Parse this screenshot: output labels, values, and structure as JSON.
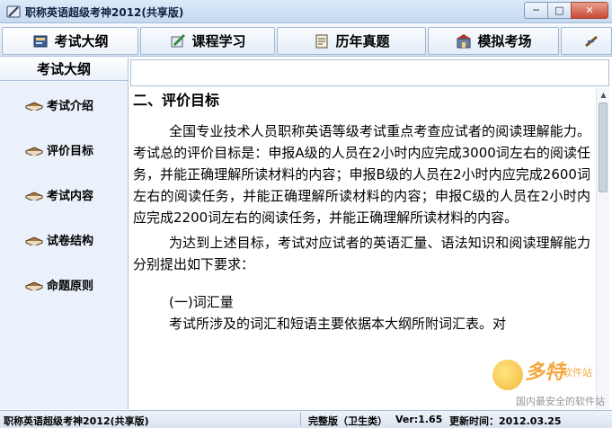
{
  "window": {
    "title": "职称英语超级考神2012(共享版)",
    "minimize_glyph": "─",
    "maximize_glyph": "□",
    "close_glyph": "✕"
  },
  "topnav": {
    "tabs": [
      {
        "label": "考试大纲",
        "icon": "book-icon"
      },
      {
        "label": "课程学习",
        "icon": "pencil-icon"
      },
      {
        "label": "历年真题",
        "icon": "test-paper-icon"
      },
      {
        "label": "模拟考场",
        "icon": "building-icon"
      }
    ]
  },
  "sidebar": {
    "header": "考试大纲",
    "items": [
      {
        "label": "考试介绍"
      },
      {
        "label": "评价目标"
      },
      {
        "label": "考试内容"
      },
      {
        "label": "试卷结构"
      },
      {
        "label": "命题原则"
      }
    ]
  },
  "content": {
    "heading": "二、评价目标",
    "para1": "全国专业技术人员职称英语等级考试重点考查应试者的阅读理解能力。考试总的评价目标是：申报A级的人员在2小时内应完成3000词左右的阅读任务，并能正确理解所读材料的内容；申报B级的人员在2小时内应完成2600词左右的阅读任务，并能正确理解所读材料的内容；申报C级的人员在2小时内应完成2200词左右的阅读任务，并能正确理解所读材料的内容。",
    "para2": "为达到上述目标，考试对应试者的英语汇量、语法知识和阅读理解能力分别提出如下要求：",
    "subheading": "(一)词汇量",
    "para3": "考试所涉及的词汇和短语主要依据本大纲所附词汇表。对"
  },
  "statusbar": {
    "app_name": "职称英语超级考神2012(共享版)",
    "edition": "完整版（卫生类）",
    "version": "Ver:1.65",
    "update_time": "更新时间：2012.03.25"
  },
  "watermark": {
    "brand": "多特",
    "brand_sub": "软件站",
    "slogan": "国内最安全的软件站"
  },
  "colors": {
    "accent": "#c5daf1",
    "close": "#c74a34",
    "icon_brown": "#8a5a2b"
  }
}
